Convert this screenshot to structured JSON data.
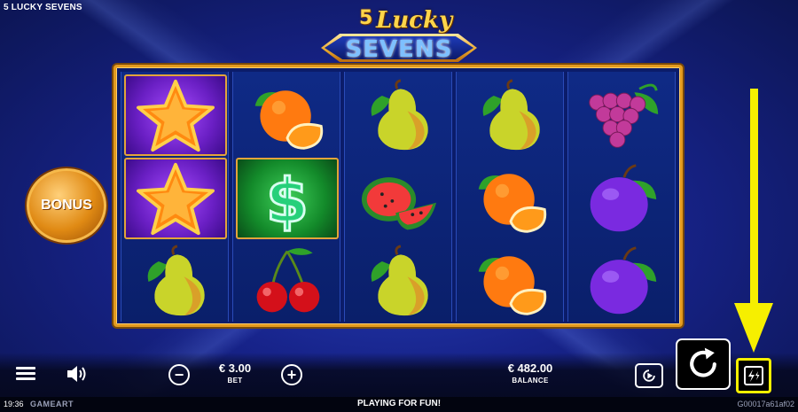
{
  "window": {
    "title": "5 LUCKY SEVENS"
  },
  "logo": {
    "number": "5",
    "word1": "Lucky",
    "word2": "SEVENS"
  },
  "bonus": {
    "label": "BONUS"
  },
  "reels": [
    [
      "star",
      "star",
      "pear"
    ],
    [
      "orange",
      "dollar",
      "cherries"
    ],
    [
      "pear",
      "watermelon",
      "pear"
    ],
    [
      "pear",
      "orange",
      "orange"
    ],
    [
      "grapes",
      "plum",
      "plum"
    ]
  ],
  "controls": {
    "bet_value": "€ 3.00",
    "bet_label": "BET",
    "balance_value": "€ 482.00",
    "balance_label": "BALANCE",
    "minus_symbol": "−",
    "plus_symbol": "+"
  },
  "footer": {
    "time": "19:36",
    "brand": "GAMEART",
    "status": "PLAYING FOR FUN!",
    "game_id": "G00017a61af02"
  },
  "colors": {
    "highlight": "#f6ef00",
    "frame_gold": "#e39a1e",
    "background": "#17238a"
  }
}
